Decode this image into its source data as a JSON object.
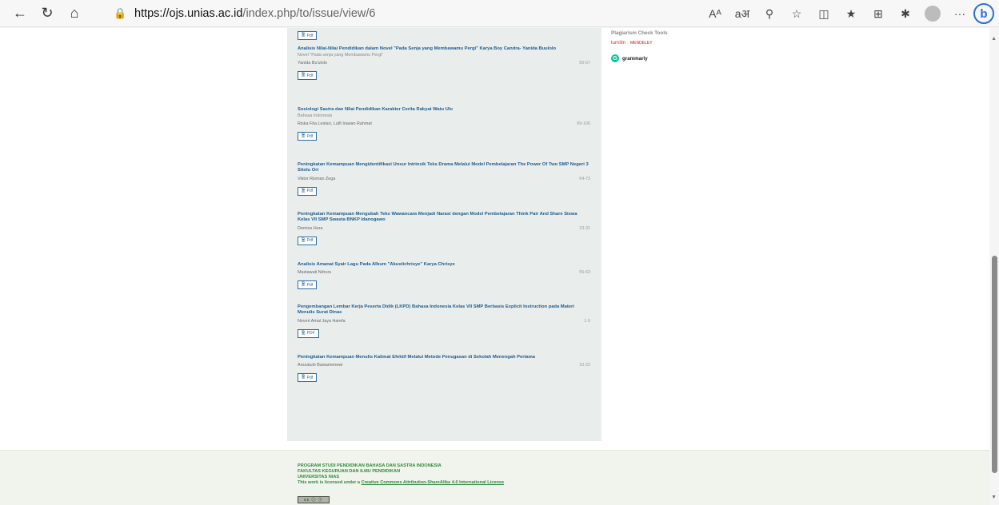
{
  "browser": {
    "url_host": "https://ojs.unias.ac.id",
    "url_path": "/index.php/to/issue/view/6",
    "icons": [
      "back-icon",
      "reload-icon",
      "home-icon",
      "lock-icon",
      "read-aloud-icon",
      "translate-icon",
      "zoom-icon",
      "favorite-icon",
      "split-screen-icon",
      "favorites-list-icon",
      "collections-icon",
      "extensions-icon",
      "profile-icon",
      "more-icon",
      "bing-icon"
    ],
    "read_aloud": "Aᴬ",
    "translate": "aअ",
    "more": "···",
    "bing": "b"
  },
  "top_pdf_label": "Pdf",
  "articles": [
    {
      "title": "Analisis Nilai-Nilai Pendidikan dalam Novel \"Pada Senja yang Membawamu Pergi\" Karya Boy Candra- Yanida Buulolo",
      "subtitle": "Novel \"Pada senja yang Membawamu Pergi\"",
      "authors": "Yanida Bu'ulolo",
      "pages": "50-57",
      "pdf": "Pdf"
    },
    {
      "title": "Sosiologi Sastra dan Nilai Pendidikan Karakter Cerita Rakyat Watu Ulo",
      "subtitle": "Bahasa Indonesia",
      "authors": "Riska Fita Lestari, Lutfi Irawan Rahmat",
      "pages": "89-100",
      "pdf": "Pdf"
    },
    {
      "title": "Peningkatan Kemampuan Mengidentifikasi Unsur Intrinsik Teks Drama Melalui Model Pembelajaran The Power Of Two SMP Negeri 3 Sitolu Ori",
      "subtitle": "",
      "authors": "Viktor Risman Zega",
      "pages": "64-73",
      "pdf": "Pdf"
    },
    {
      "title": "Peningkatan Kemampuan Mengubah Teks Wawancara Menjadi Narasi dengan Model Pembelajaran Think Pair And Share Siswa Kelas VII SMP Swasta BNKP Idanogawo",
      "subtitle": "",
      "authors": "Demius Hura",
      "pages": "23-31",
      "pdf": "Pdf"
    },
    {
      "title": "Analisis Amanat Syair Lagu Pada Album \"Akustichrisye\" Karya Chrisye",
      "subtitle": "",
      "authors": "Mastawati Ndruru",
      "pages": "55-63",
      "pdf": "Pdf"
    },
    {
      "title": "Pengembangan Lembar Kerja Peserta Didik (LKPD) Bahasa Indonesia Kelas VII SMP Berbasis Explicit Instruction pada Materi Menulis Surat Dinas",
      "subtitle": "",
      "authors": "Noveri Amal Jaya Harefa",
      "pages": "1-9",
      "pdf": "PDF"
    },
    {
      "title": "Peningkatan Kemampuan Menulis Kalimat Efektif Melalui Metode Penugasan di Sekolah Menengah Pertama",
      "subtitle": "",
      "authors": "Arozatulo Bawamenewi",
      "pages": "10-22",
      "pdf": "Pdf"
    }
  ],
  "sidebar": {
    "title": "Plagiarism Check Tools",
    "turnitin": "turnitin",
    "mendeley": "MENDELEY",
    "grammarly": "grammarly"
  },
  "footer": {
    "line1": "PROGRAM STUDI PENDIDIKAN BAHASA DAN SASTRA INDONESIA",
    "line2": "FAKULTAS KEGURUAN DAN ILMU PENDIDIKAN",
    "line3": "UNIVERSITAS NIAS",
    "license_prefix": "This work is licensed under a ",
    "license_link": "Creative Commons Attribution-ShareAlike 4.0 International License",
    "cc_badge": "cc ⓘ ⓢ"
  },
  "colors": {
    "title_blue": "#1d5c8f",
    "footer_green": "#2f8a3c",
    "main_bg": "#e9eeec"
  }
}
